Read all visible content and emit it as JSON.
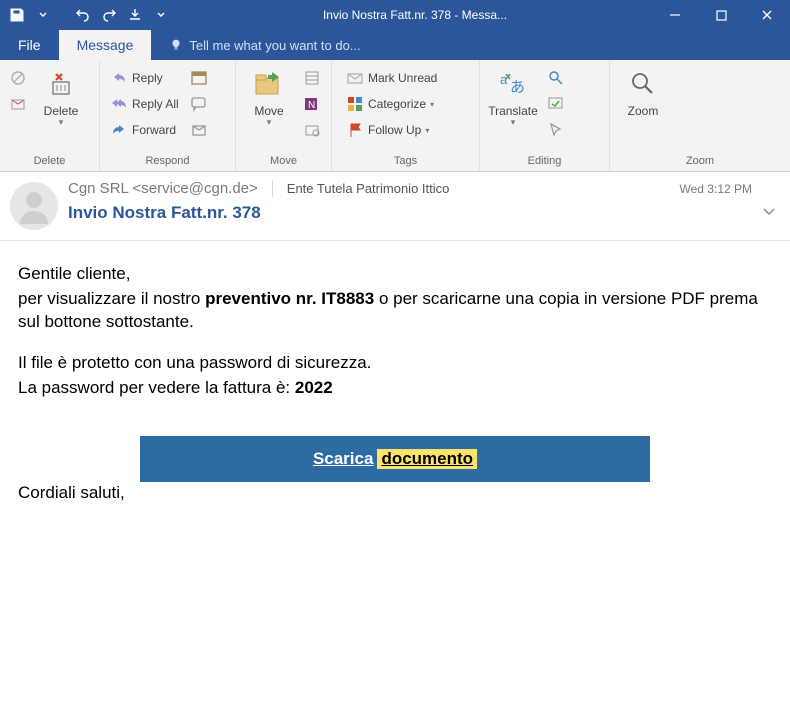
{
  "titlebar": {
    "title": "Invio Nostra Fatt.nr. 378 - Messa..."
  },
  "tabs": {
    "file": "File",
    "message": "Message",
    "tellme": "Tell me what you want to do..."
  },
  "ribbon": {
    "delete": {
      "main": "Delete",
      "group": "Delete"
    },
    "respond": {
      "reply": "Reply",
      "replyall": "Reply All",
      "forward": "Forward",
      "group": "Respond"
    },
    "move": {
      "main": "Move",
      "group": "Move"
    },
    "tags": {
      "unread": "Mark Unread",
      "categorize": "Categorize",
      "followup": "Follow Up",
      "group": "Tags"
    },
    "editing": {
      "translate": "Translate",
      "group": "Editing"
    },
    "zoom": {
      "main": "Zoom",
      "group": "Zoom"
    }
  },
  "header": {
    "from": "Cgn SRL <service@cgn.de>",
    "to": "Ente Tutela Patrimonio Ittico",
    "date": "Wed 3:12 PM",
    "subject": "Invio Nostra Fatt.nr. 378"
  },
  "body": {
    "greeting": "Gentile cliente,",
    "line1a": "per visualizzare il nostro ",
    "line1b": "preventivo nr. IT8883",
    "line1c": " o per scaricarne una copia in versione PDF prema sul bottone sottostante.",
    "line2": "Il file è protetto con una password di sicurezza.",
    "line3a": "La password per vedere la fattura è: ",
    "line3b": "2022",
    "btn1": "Scarica",
    "btn2": "documento",
    "closing": "Cordiali saluti,"
  }
}
